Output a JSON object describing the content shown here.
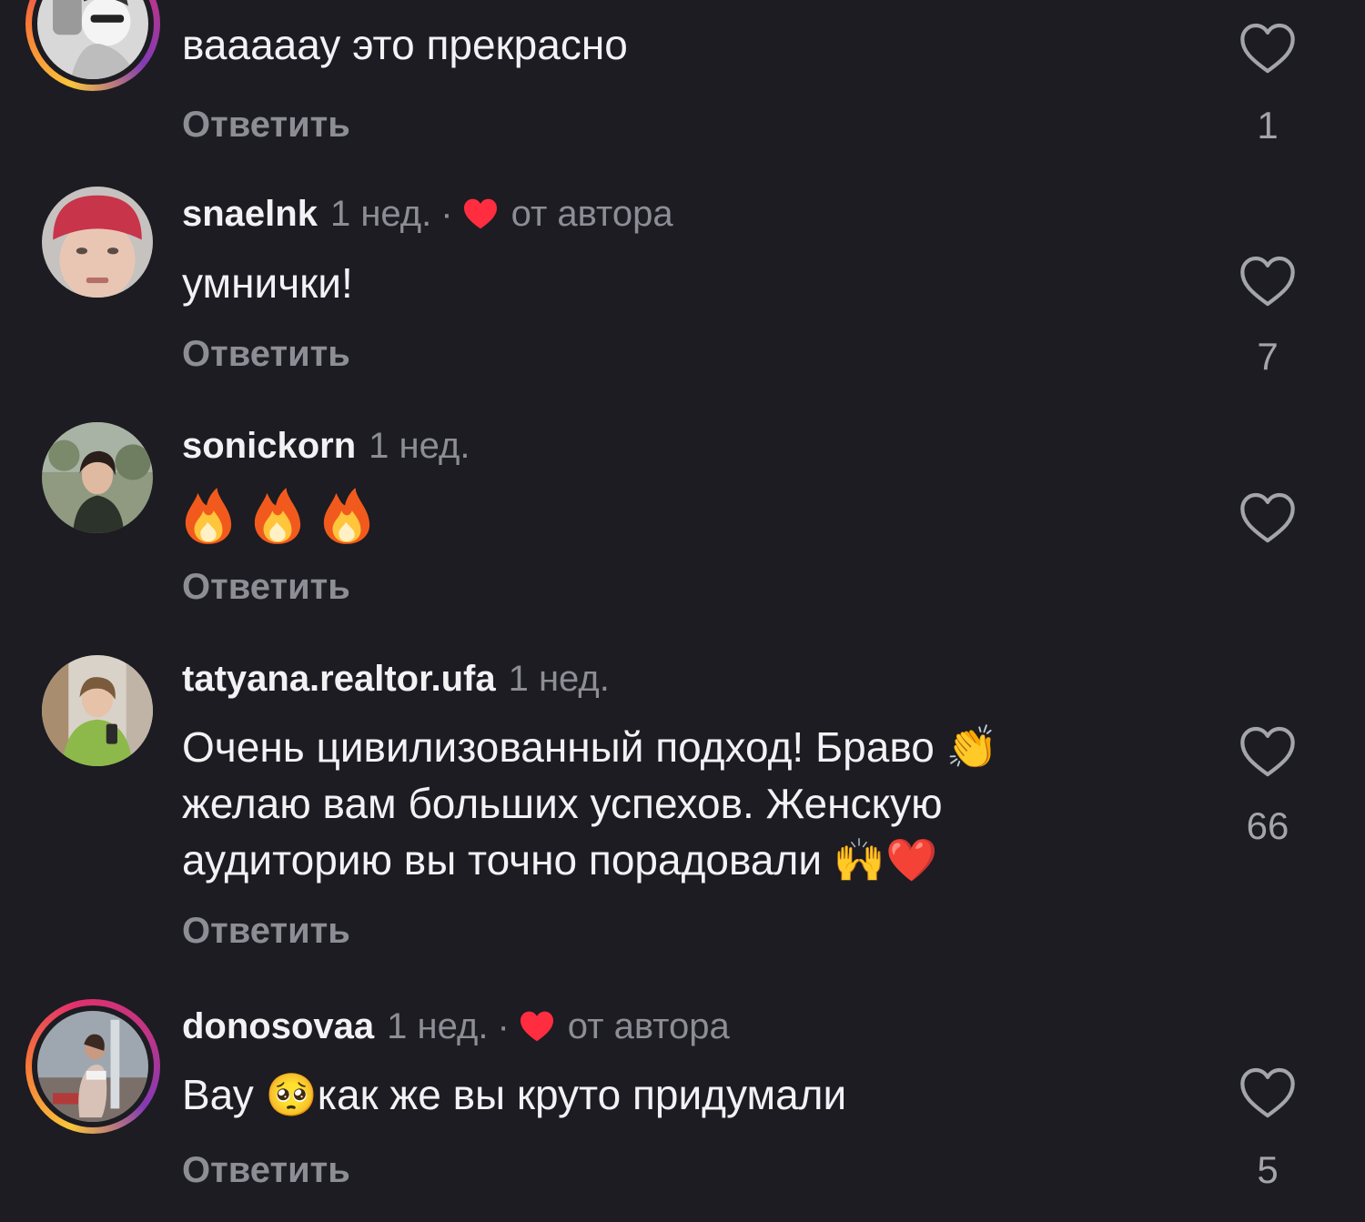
{
  "comments": [
    {
      "username": "",
      "time": "",
      "text": "вааааау это прекрасно",
      "reply": "Ответить",
      "likes": "1"
    },
    {
      "username": "snaelnk",
      "time": "1 нед.",
      "author_liked": true,
      "author_label": "от автора",
      "text": "умнички!",
      "reply": "Ответить",
      "likes": "7"
    },
    {
      "username": "sonickorn",
      "time": "1 нед.",
      "text_emoji": [
        "fire-emoji",
        "fire-emoji",
        "fire-emoji"
      ],
      "reply": "Ответить",
      "likes": ""
    },
    {
      "username": "tatyana.realtor.ufa",
      "time": "1 нед.",
      "text_lines": [
        "Очень цивилизованный подход! Браво 👏",
        "желаю вам больших успехов. Женскую",
        "аудиторию вы точно порадовали 🙌❤️"
      ],
      "reply": "Ответить",
      "likes": "66"
    },
    {
      "username": "donosovaa",
      "time": "1 нед.",
      "author_liked": true,
      "author_label": "от автора",
      "text": "Вау 🥺как же вы круто придумали",
      "reply": "Ответить",
      "likes": "5"
    }
  ],
  "colors": {
    "background": "#1c1c22",
    "text": "#f2f2f5",
    "muted": "#8d8d96",
    "author_heart": "#ff2d3f"
  }
}
